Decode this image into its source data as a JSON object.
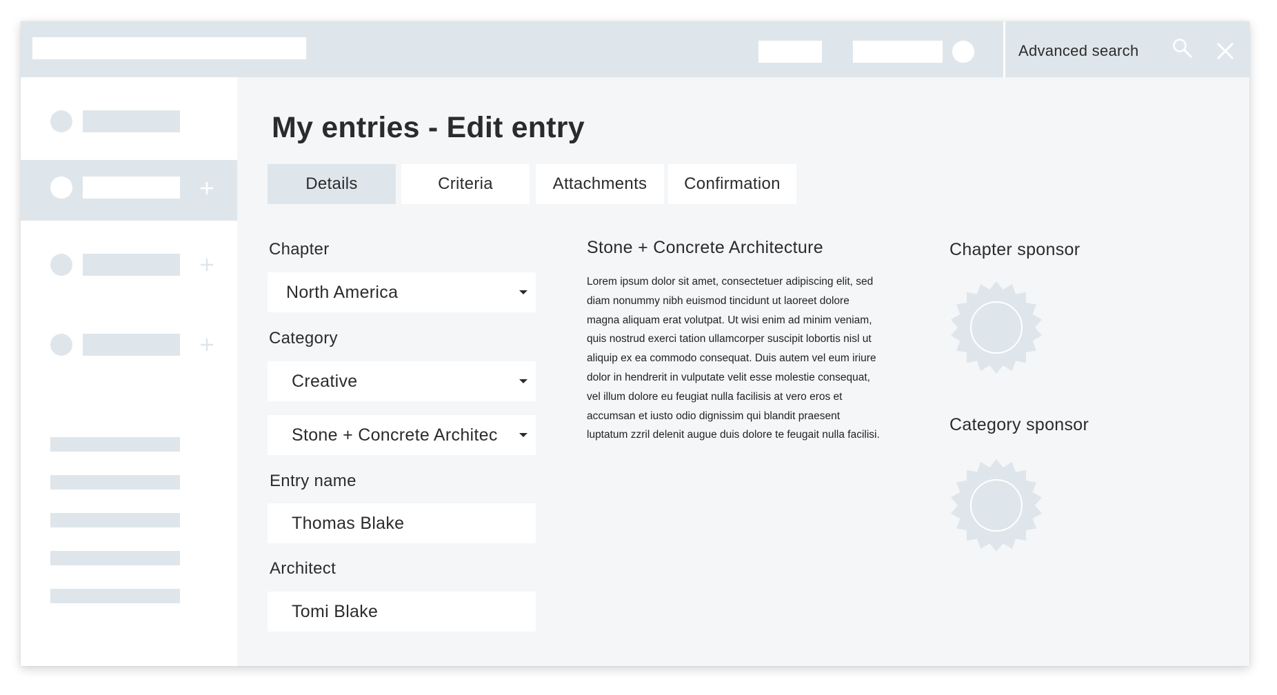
{
  "topbar": {
    "advanced_search_label": "Advanced search",
    "search_icon": "search-icon",
    "close_icon": "close-icon"
  },
  "sidebar": {
    "expand_icon": "plus-icon"
  },
  "page_title": "My entries - Edit entry",
  "tabs": [
    {
      "label": "Details",
      "active": true
    },
    {
      "label": "Criteria",
      "active": false
    },
    {
      "label": "Attachments",
      "active": false
    },
    {
      "label": "Confirmation",
      "active": false
    }
  ],
  "form": {
    "chapter": {
      "label": "Chapter",
      "value": "North America"
    },
    "category": {
      "label": "Category",
      "value": "Creative"
    },
    "subcategory": {
      "value": "Stone + Concrete Architec"
    },
    "entry_name": {
      "label": "Entry name",
      "value": "Thomas Blake"
    },
    "architect": {
      "label": "Architect",
      "value": "Tomi Blake"
    }
  },
  "description": {
    "title": "Stone + Concrete Architecture",
    "body": "Lorem ipsum dolor sit amet, consectetuer adipiscing elit, sed diam nonummy nibh euismod tincidunt ut laoreet dolore magna aliquam erat volutpat. Ut wisi enim ad minim veniam, quis nostrud exerci tation ullamcorper suscipit lobortis nisl ut aliquip ex ea commodo consequat. Duis autem vel eum iriure dolor in hendrerit in vulputate velit esse molestie consequat, vel illum dolore eu feugiat nulla facilisis at vero eros et accumsan et iusto odio dignissim qui blandit praesent luptatum zzril delenit augue duis dolore te feugait nulla facilisi."
  },
  "sponsors": {
    "chapter_label": "Chapter sponsor",
    "category_label": "Category sponsor",
    "badge_icon": "sponsor-badge-icon"
  },
  "colors": {
    "placeholder": "#dfe6eb",
    "background": "#f4f6f8",
    "text": "#2b2b2b"
  }
}
